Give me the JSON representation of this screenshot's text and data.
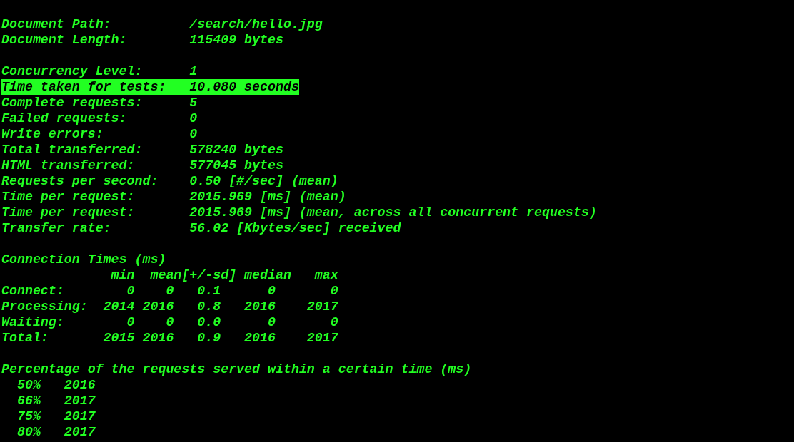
{
  "document": [
    {
      "label": "Document Path:",
      "value": "/search/hello.jpg",
      "highlighted": false
    },
    {
      "label": "Document Length:",
      "value": "115409 bytes",
      "highlighted": false
    }
  ],
  "stats": [
    {
      "label": "Concurrency Level:",
      "value": "1",
      "highlighted": false
    },
    {
      "label": "Time taken for tests:",
      "value": "10.080 seconds",
      "highlighted": true
    },
    {
      "label": "Complete requests:",
      "value": "5",
      "highlighted": false
    },
    {
      "label": "Failed requests:",
      "value": "0",
      "highlighted": false
    },
    {
      "label": "Write errors:",
      "value": "0",
      "highlighted": false
    },
    {
      "label": "Total transferred:",
      "value": "578240 bytes",
      "highlighted": false
    },
    {
      "label": "HTML transferred:",
      "value": "577045 bytes",
      "highlighted": false
    },
    {
      "label": "Requests per second:",
      "value": "0.50 [#/sec] (mean)",
      "highlighted": false
    },
    {
      "label": "Time per request:",
      "value": "2015.969 [ms] (mean)",
      "highlighted": false
    },
    {
      "label": "Time per request:",
      "value": "2015.969 [ms] (mean, across all concurrent requests)",
      "highlighted": false
    },
    {
      "label": "Transfer rate:",
      "value": "56.02 [Kbytes/sec] received",
      "highlighted": false
    }
  ],
  "connection_times": {
    "title": "Connection Times (ms)",
    "lines": [
      "              min  mean[+/-sd] median   max",
      "Connect:        0    0   0.1      0       0",
      "Processing:  2014 2016   0.8   2016    2017",
      "Waiting:        0    0   0.0      0       0",
      "Total:       2015 2016   0.9   2016    2017"
    ]
  },
  "percentiles": {
    "title": "Percentage of the requests served within a certain time (ms)",
    "lines": [
      "  50%   2016",
      "  66%   2017",
      "  75%   2017",
      "  80%   2017"
    ]
  }
}
